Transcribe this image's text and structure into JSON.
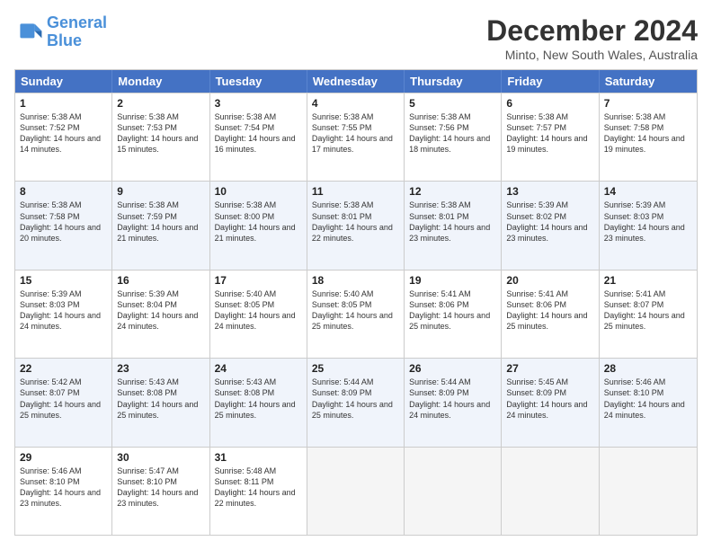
{
  "logo": {
    "line1": "General",
    "line2": "Blue"
  },
  "title": "December 2024",
  "subtitle": "Minto, New South Wales, Australia",
  "days": [
    "Sunday",
    "Monday",
    "Tuesday",
    "Wednesday",
    "Thursday",
    "Friday",
    "Saturday"
  ],
  "weeks": [
    [
      {
        "day": "1",
        "sunrise": "5:38 AM",
        "sunset": "7:52 PM",
        "daylight": "14 hours and 14 minutes."
      },
      {
        "day": "2",
        "sunrise": "5:38 AM",
        "sunset": "7:53 PM",
        "daylight": "14 hours and 15 minutes."
      },
      {
        "day": "3",
        "sunrise": "5:38 AM",
        "sunset": "7:54 PM",
        "daylight": "14 hours and 16 minutes."
      },
      {
        "day": "4",
        "sunrise": "5:38 AM",
        "sunset": "7:55 PM",
        "daylight": "14 hours and 17 minutes."
      },
      {
        "day": "5",
        "sunrise": "5:38 AM",
        "sunset": "7:56 PM",
        "daylight": "14 hours and 18 minutes."
      },
      {
        "day": "6",
        "sunrise": "5:38 AM",
        "sunset": "7:57 PM",
        "daylight": "14 hours and 19 minutes."
      },
      {
        "day": "7",
        "sunrise": "5:38 AM",
        "sunset": "7:58 PM",
        "daylight": "14 hours and 19 minutes."
      }
    ],
    [
      {
        "day": "8",
        "sunrise": "5:38 AM",
        "sunset": "7:58 PM",
        "daylight": "14 hours and 20 minutes."
      },
      {
        "day": "9",
        "sunrise": "5:38 AM",
        "sunset": "7:59 PM",
        "daylight": "14 hours and 21 minutes."
      },
      {
        "day": "10",
        "sunrise": "5:38 AM",
        "sunset": "8:00 PM",
        "daylight": "14 hours and 21 minutes."
      },
      {
        "day": "11",
        "sunrise": "5:38 AM",
        "sunset": "8:01 PM",
        "daylight": "14 hours and 22 minutes."
      },
      {
        "day": "12",
        "sunrise": "5:38 AM",
        "sunset": "8:01 PM",
        "daylight": "14 hours and 23 minutes."
      },
      {
        "day": "13",
        "sunrise": "5:39 AM",
        "sunset": "8:02 PM",
        "daylight": "14 hours and 23 minutes."
      },
      {
        "day": "14",
        "sunrise": "5:39 AM",
        "sunset": "8:03 PM",
        "daylight": "14 hours and 23 minutes."
      }
    ],
    [
      {
        "day": "15",
        "sunrise": "5:39 AM",
        "sunset": "8:03 PM",
        "daylight": "14 hours and 24 minutes."
      },
      {
        "day": "16",
        "sunrise": "5:39 AM",
        "sunset": "8:04 PM",
        "daylight": "14 hours and 24 minutes."
      },
      {
        "day": "17",
        "sunrise": "5:40 AM",
        "sunset": "8:05 PM",
        "daylight": "14 hours and 24 minutes."
      },
      {
        "day": "18",
        "sunrise": "5:40 AM",
        "sunset": "8:05 PM",
        "daylight": "14 hours and 25 minutes."
      },
      {
        "day": "19",
        "sunrise": "5:41 AM",
        "sunset": "8:06 PM",
        "daylight": "14 hours and 25 minutes."
      },
      {
        "day": "20",
        "sunrise": "5:41 AM",
        "sunset": "8:06 PM",
        "daylight": "14 hours and 25 minutes."
      },
      {
        "day": "21",
        "sunrise": "5:41 AM",
        "sunset": "8:07 PM",
        "daylight": "14 hours and 25 minutes."
      }
    ],
    [
      {
        "day": "22",
        "sunrise": "5:42 AM",
        "sunset": "8:07 PM",
        "daylight": "14 hours and 25 minutes."
      },
      {
        "day": "23",
        "sunrise": "5:43 AM",
        "sunset": "8:08 PM",
        "daylight": "14 hours and 25 minutes."
      },
      {
        "day": "24",
        "sunrise": "5:43 AM",
        "sunset": "8:08 PM",
        "daylight": "14 hours and 25 minutes."
      },
      {
        "day": "25",
        "sunrise": "5:44 AM",
        "sunset": "8:09 PM",
        "daylight": "14 hours and 25 minutes."
      },
      {
        "day": "26",
        "sunrise": "5:44 AM",
        "sunset": "8:09 PM",
        "daylight": "14 hours and 24 minutes."
      },
      {
        "day": "27",
        "sunrise": "5:45 AM",
        "sunset": "8:09 PM",
        "daylight": "14 hours and 24 minutes."
      },
      {
        "day": "28",
        "sunrise": "5:46 AM",
        "sunset": "8:10 PM",
        "daylight": "14 hours and 24 minutes."
      }
    ],
    [
      {
        "day": "29",
        "sunrise": "5:46 AM",
        "sunset": "8:10 PM",
        "daylight": "14 hours and 23 minutes."
      },
      {
        "day": "30",
        "sunrise": "5:47 AM",
        "sunset": "8:10 PM",
        "daylight": "14 hours and 23 minutes."
      },
      {
        "day": "31",
        "sunrise": "5:48 AM",
        "sunset": "8:11 PM",
        "daylight": "14 hours and 22 minutes."
      },
      null,
      null,
      null,
      null
    ]
  ],
  "labels": {
    "sunrise_prefix": "Sunrise: ",
    "sunset_prefix": "Sunset: ",
    "daylight_prefix": "Daylight: "
  }
}
